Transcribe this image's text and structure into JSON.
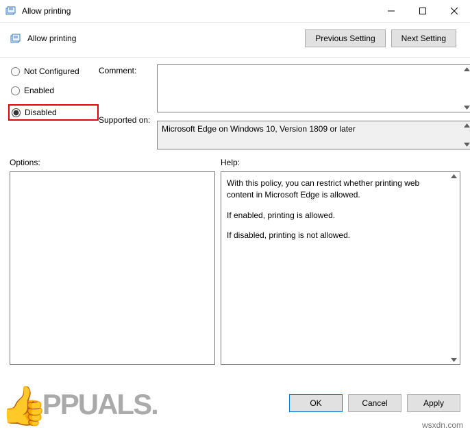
{
  "window": {
    "title": "Allow printing"
  },
  "header": {
    "policy_name": "Allow printing",
    "prev_btn": "Previous Setting",
    "next_btn": "Next Setting"
  },
  "state_radios": {
    "not_configured": "Not Configured",
    "enabled": "Enabled",
    "disabled": "Disabled",
    "selected": "disabled"
  },
  "labels": {
    "comment": "Comment:",
    "supported": "Supported on:",
    "options": "Options:",
    "help": "Help:"
  },
  "fields": {
    "comment": "",
    "supported_on": "Microsoft Edge on Windows 10, Version 1809 or later"
  },
  "help_text": {
    "p1": "With this policy, you can restrict whether printing web content in Microsoft Edge is allowed.",
    "p2": "If enabled, printing is allowed.",
    "p3": "If disabled, printing is not allowed."
  },
  "footer": {
    "ok": "OK",
    "cancel": "Cancel",
    "apply": "Apply"
  },
  "overlay": {
    "left_brand": "PPUALS.",
    "right_site": "wsxdn.com"
  }
}
